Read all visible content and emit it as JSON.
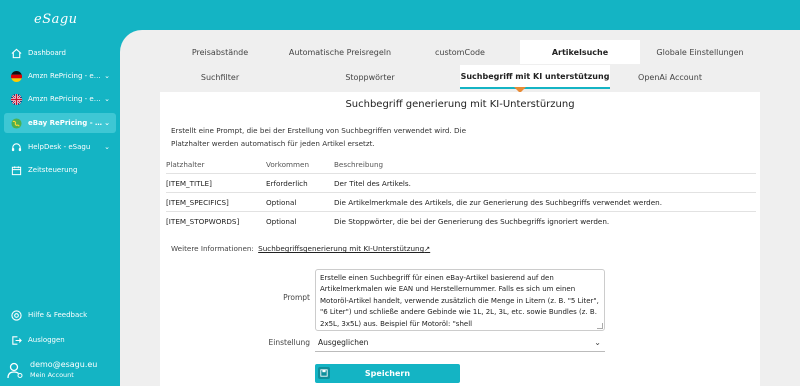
{
  "app": {
    "logo_text": "eSagu"
  },
  "sidebar": {
    "items": [
      {
        "label": "Dashboard",
        "icon": "home-icon",
        "chevron": false,
        "active": false
      },
      {
        "label": "Amzn RePricing - eSa...",
        "icon": "germany-flag-icon",
        "chevron": true,
        "active": false
      },
      {
        "label": "Amzn RePricing - eSa...",
        "icon": "uk-flag-icon",
        "chevron": true,
        "active": false
      },
      {
        "label": "eBay RePricing - e...",
        "icon": "globe-icon",
        "chevron": true,
        "active": true
      },
      {
        "label": "HelpDesk - eSagu",
        "icon": "headset-icon",
        "chevron": true,
        "active": false
      },
      {
        "label": "Zeitsteuerung",
        "icon": "calendar-icon",
        "chevron": false,
        "active": false
      }
    ],
    "help_label": "Hilfe & Feedback",
    "logout_label": "Ausloggen",
    "account": {
      "email": "demo@esagu.eu",
      "sub": "Mein Account"
    }
  },
  "tabs_top": [
    "Preisabstände",
    "Automatische Preisregeln",
    "customCode",
    "Artikelsuche",
    "Globale Einstellungen"
  ],
  "tabs_top_active": "Artikelsuche",
  "tabs_sub": [
    "Suchfilter",
    "Stoppwörter",
    "Suchbegriff mit KI unterstützung",
    "OpenAi Account"
  ],
  "tabs_sub_active": "Suchbegriff mit KI unterstützung",
  "card": {
    "title": "Suchbegriff generierung mit KI-Unterstürzung",
    "description": "Erstellt eine Prompt, die bei der Erstellung von Suchbegriffen verwendet wird. Die Platzhalter werden automatisch für jeden Artikel ersetzt.",
    "table": {
      "headers": [
        "Platzhalter",
        "Vorkommen",
        "Beschreibung"
      ],
      "rows": [
        [
          "[ITEM_TITLE]",
          "Erforderlich",
          "Der Titel des Artikels."
        ],
        [
          "[ITEM_SPECIFICS]",
          "Optional",
          "Die Artikelmerkmale des Artikels, die zur Generierung des Suchbegriffs verwendet werden."
        ],
        [
          "[ITEM_STOPWORDS]",
          "Optional",
          "Die Stoppwörter, die bei der Generierung des Suchbegriffs ignoriert werden."
        ]
      ]
    },
    "more_info_label": "Weitere Informationen:",
    "more_info_link": "Suchbegriffsgenerierung mit KI-Unterstützung",
    "prompt_label": "Prompt",
    "prompt_value": "Erstelle einen Suchbegriff für einen eBay-Artikel basierend auf den Artikelmerkmalen wie EAN und Herstellernummer. Falls es sich um einen Motoröl-Artikel handelt, verwende zusätzlich die Menge in Litern (z. B. \"5 Liter\", \"6 Liter\") und schließe andere Gebinde wie 1L, 2L, 3L, etc. sowie Bundles (z. B. 2x5L, 3x5L) aus. Beispiel für Motoröl: \"shell",
    "setting_label": "Einstellung",
    "setting_value": "Ausgeglichen",
    "save_label": "Speichern"
  },
  "colors": {
    "accent": "#14b4c4",
    "indicator": "#e98b35",
    "content_bg": "#efefef"
  }
}
